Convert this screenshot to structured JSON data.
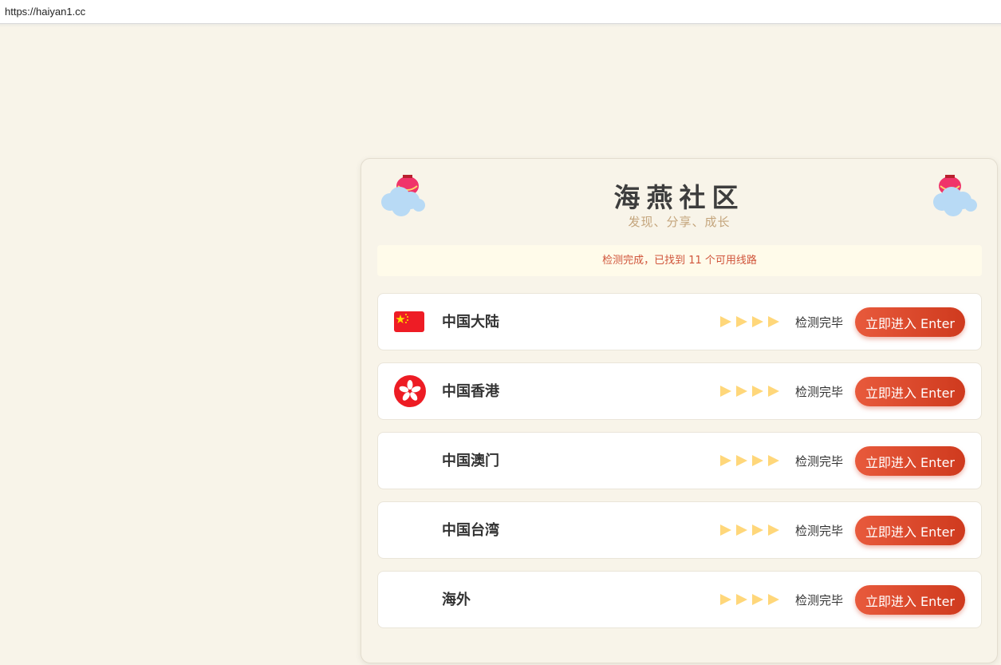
{
  "browser": {
    "url": "https://haiyan1.cc"
  },
  "header": {
    "title": "海燕社区",
    "subtitle": "发现、分享、成长"
  },
  "notice": "检测完成，已找到 11 个可用线路",
  "routes": [
    {
      "region": "中国大陆",
      "status": "检测完毕",
      "enter_label": "立即进入 Enter",
      "flag": "china-flag-icon"
    },
    {
      "region": "中国香港",
      "status": "检测完毕",
      "enter_label": "立即进入 Enter",
      "flag": "hong-kong-flag-icon"
    },
    {
      "region": "中国澳门",
      "status": "检测完毕",
      "enter_label": "立即进入 Enter",
      "flag": ""
    },
    {
      "region": "中国台湾",
      "status": "检测完毕",
      "enter_label": "立即进入 Enter",
      "flag": ""
    },
    {
      "region": "海外",
      "status": "检测完毕",
      "enter_label": "立即进入 Enter",
      "flag": ""
    }
  ],
  "colors": {
    "background": "#f8f4e9",
    "accent": "#d9432a",
    "notice_text": "#d0543a",
    "signal": "#ffd77a"
  },
  "icons": {
    "decoration": "lantern-cloud-icon",
    "signal": "signal-strength-icon"
  }
}
